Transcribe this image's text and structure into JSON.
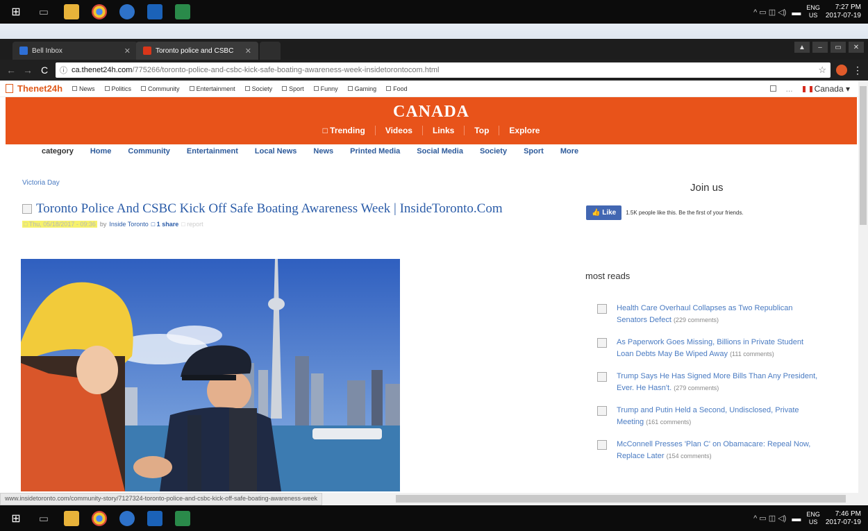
{
  "taskbar_top": {
    "icons": [
      "windows-icon",
      "task-view-icon",
      "file-explorer-icon",
      "chrome-icon",
      "media-icon",
      "outlook-icon",
      "excel-icon"
    ],
    "lang": [
      "ENG",
      "US"
    ],
    "time": "7:27 PM",
    "date": "2017-07-19"
  },
  "taskbar_bottom": {
    "lang": [
      "ENG",
      "US"
    ],
    "time": "7:46 PM",
    "date": "2017-07-19"
  },
  "browser": {
    "tabs": [
      {
        "label": "Bell Inbox",
        "active": false
      },
      {
        "label": "Toronto police and CSBC",
        "active": true
      }
    ],
    "url_host": "ca.thenet24h.com",
    "url_path": "/775266/toronto-police-and-csbc-kick-safe-boating-awareness-week-insidetorontocom.html"
  },
  "site": {
    "logo": "Thenet24h",
    "top_nav": [
      "News",
      "Politics",
      "Community",
      "Entertainment",
      "Society",
      "Sport",
      "Funny",
      "Gaming",
      "Food"
    ],
    "right_dots": "...",
    "region": "Canada ▾",
    "banner_title": "CANADA",
    "banner_links": [
      "□ Trending",
      "Videos",
      "Links",
      "Top",
      "Explore"
    ],
    "category_label": "category",
    "category_nav": [
      "Home",
      "Community",
      "Entertainment",
      "Local News",
      "News",
      "Printed Media",
      "Social Media",
      "Society",
      "Sport",
      "More"
    ]
  },
  "article": {
    "crumb": "Victoria Day",
    "title": "Toronto Police And CSBC Kick Off Safe Boating Awareness Week | InsideToronto.Com",
    "meta_date": "□ Thu, 05/18/2017 - 09:36",
    "meta_by": "by",
    "meta_author": "Inside Toronto",
    "meta_share": "□ 1 share",
    "meta_report": "□ report"
  },
  "sidebar": {
    "join": "Join us",
    "fb_like": "Like",
    "fb_text": "1.5K people like this. Be the first of your friends.",
    "most_reads": "most reads",
    "reads": [
      {
        "title": "Health Care Overhaul Collapses as Two Republican Senators Defect",
        "comments": "(229 comments)"
      },
      {
        "title": "As Paperwork Goes Missing, Billions in Private Student Loan Debts May Be Wiped Away",
        "comments": "(111 comments)"
      },
      {
        "title": "Trump Says He Has Signed More Bills Than Any President, Ever. He Hasn't.",
        "comments": "(279 comments)"
      },
      {
        "title": "Trump and Putin Held a Second, Undisclosed, Private Meeting",
        "comments": "(161 comments)"
      },
      {
        "title": "McConnell Presses 'Plan C' on Obamacare: Repeal Now, Replace Later",
        "comments": "(154 comments)"
      }
    ]
  },
  "status_url": "www.insidetoronto.com/community-story/7127324-toronto-police-and-csbc-kick-off-safe-boating-awareness-week",
  "colors": {
    "brand_orange": "#e8531a",
    "link_blue": "#2b5ca8",
    "taskbar": "#0c0c0c"
  }
}
